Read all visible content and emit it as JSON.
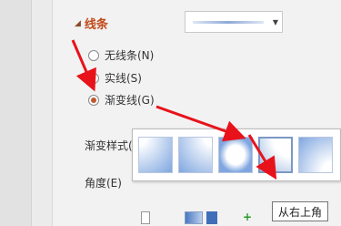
{
  "section": {
    "title": "线条",
    "expand_icon": "triangle-down-icon"
  },
  "line_dropdown": {
    "icon": "chevron-down-icon"
  },
  "radio_options": [
    {
      "label": "无线条(N)",
      "checked": false
    },
    {
      "label": "实线(S)",
      "checked": false
    },
    {
      "label": "渐变线(G)",
      "checked": true
    }
  ],
  "gradient_style_label": "渐变样式(R)",
  "angle_label": "角度(E)",
  "tooltip": "从右上角",
  "colors": {
    "accent": "#c24b1a",
    "arrow": "#e8121b",
    "gradient_blue": "#8fa9d8"
  }
}
